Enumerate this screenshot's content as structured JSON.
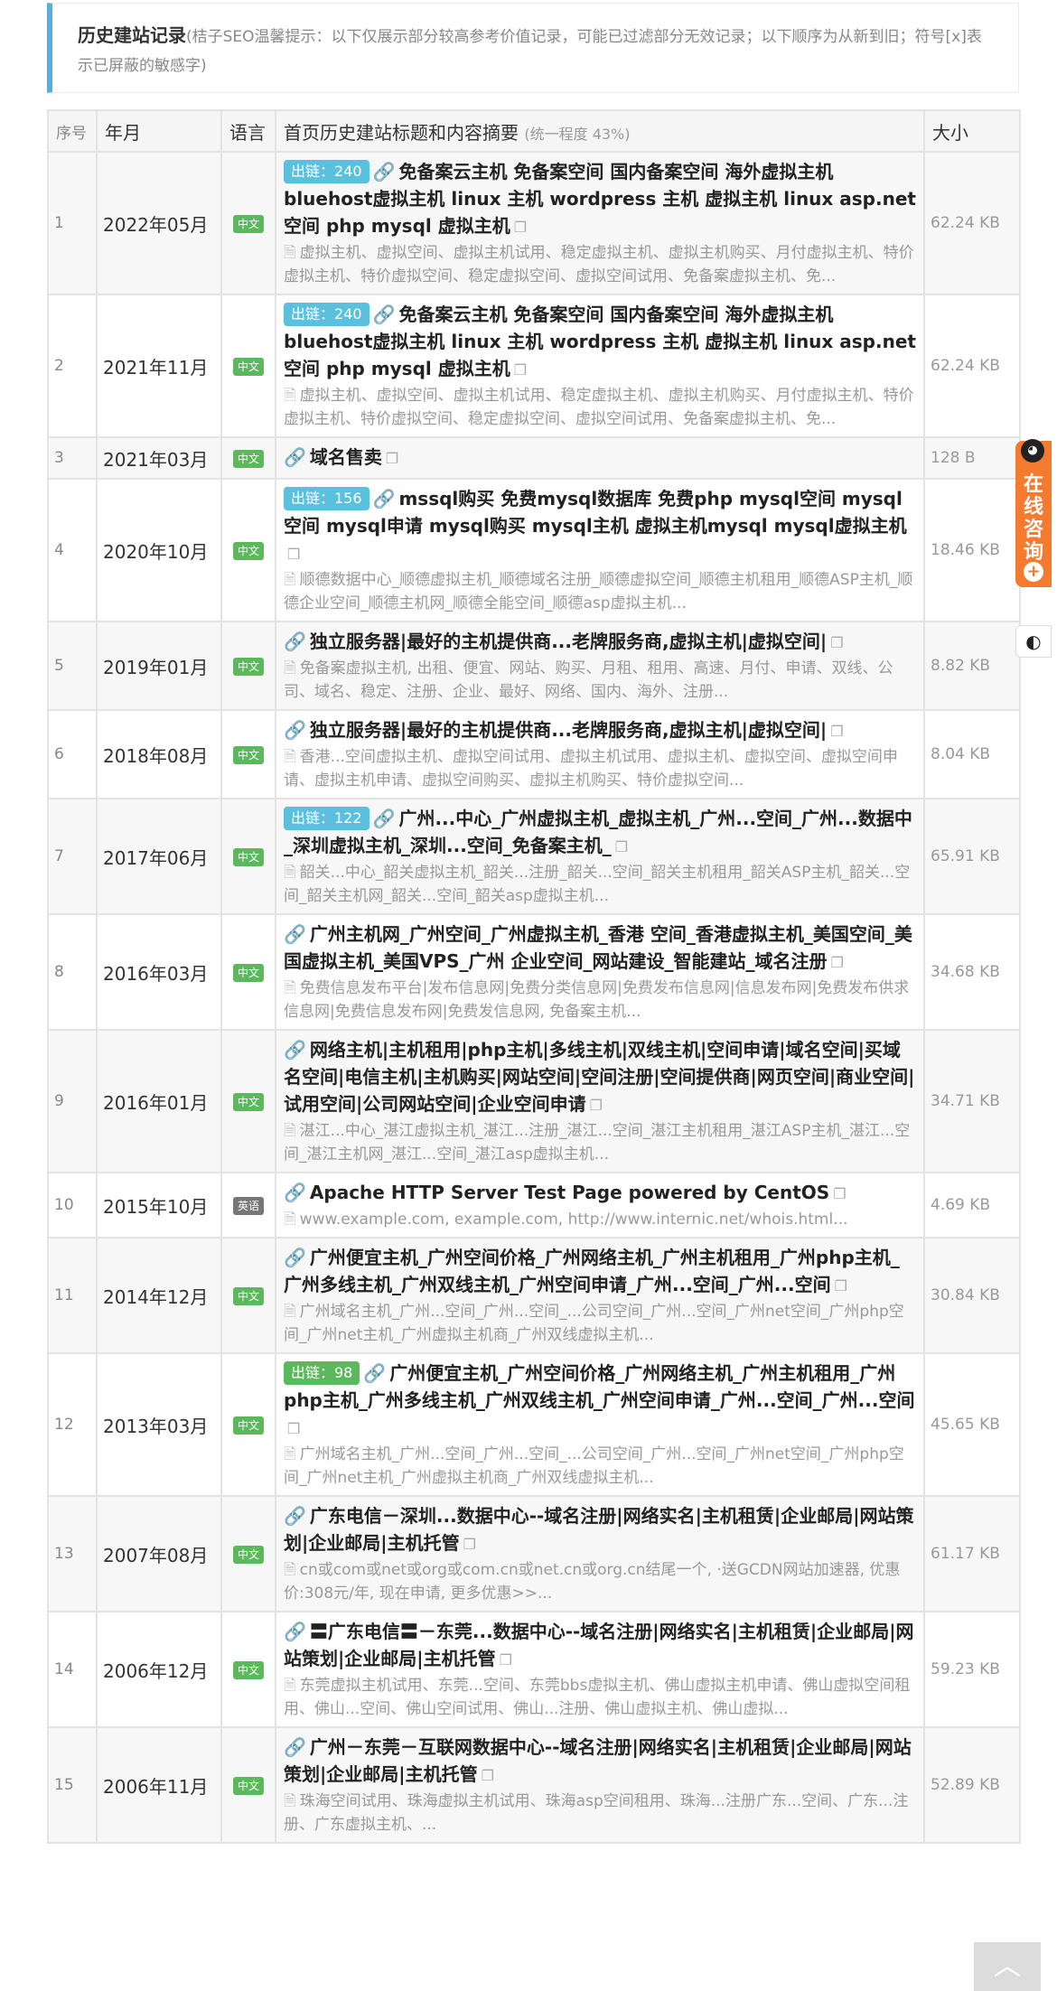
{
  "notice": {
    "title": "历史建站记录",
    "desc": "(桔子SEO温馨提示：以下仅展示部分较高参考价值记录，可能已过滤部分无效记录；以下顺序为从新到旧；符号[x]表示已屏蔽的敏感字)"
  },
  "table": {
    "headers": {
      "seq": "序号",
      "date": "年月",
      "lang": "语言",
      "title": "首页历史建站标题和内容摘要",
      "similarity": "(统一程度 43%)",
      "size": "大小"
    },
    "rows": [
      {
        "seq": "1",
        "date": "2022年05月",
        "lang": "中文",
        "chain": "出链：240",
        "title": "免备案云主机 免备案空间 国内备案空间 海外虚拟主机 bluehost虚拟主机 linux 主机 wordpress 主机 虚拟主机 linux asp.net空间 php mysql 虚拟主机",
        "summary": "虚拟主机、虚拟空间、虚拟主机试用、稳定虚拟主机、虚拟主机购买、月付虚拟主机、特价虚拟主机、特价虚拟空间、稳定虚拟空间、虚拟空间试用、免备案虚拟主机、免...",
        "size": "62.24 KB"
      },
      {
        "seq": "2",
        "date": "2021年11月",
        "lang": "中文",
        "chain": "出链：240",
        "title": "免备案云主机 免备案空间 国内备案空间 海外虚拟主机 bluehost虚拟主机 linux 主机 wordpress 主机 虚拟主机 linux asp.net空间 php mysql 虚拟主机",
        "summary": "虚拟主机、虚拟空间、虚拟主机试用、稳定虚拟主机、虚拟主机购买、月付虚拟主机、特价虚拟主机、特价虚拟空间、稳定虚拟空间、虚拟空间试用、免备案虚拟主机、免...",
        "size": "62.24 KB"
      },
      {
        "seq": "3",
        "date": "2021年03月",
        "lang": "中文",
        "chain": "",
        "title": "域名售卖",
        "summary": "",
        "size": "128 B"
      },
      {
        "seq": "4",
        "date": "2020年10月",
        "lang": "中文",
        "chain": "出链：156",
        "title": "mssql购买 免费mysql数据库 免费php mysql空间 mysql空间 mysql申请 mysql购买 mysql主机 虚拟主机mysql mysql虚拟主机",
        "summary": "顺德数据中心_顺德虚拟主机_顺德域名注册_顺德虚拟空间_顺德主机租用_顺德ASP主机_顺德企业空间_顺德主机网_顺德全能空间_顺德asp虚拟主机...",
        "size": "18.46 KB"
      },
      {
        "seq": "5",
        "date": "2019年01月",
        "lang": "中文",
        "chain": "",
        "title": "独立服务器|最好的主机提供商...老牌服务商,虚拟主机|虚拟空间|",
        "summary": "免备案虚拟主机, 出租、便宜、网站、购买、月租、租用、高速、月付、申请、双线、公司、域名、稳定、注册、企业、最好、网络、国内、海外、注册...",
        "size": "8.82 KB"
      },
      {
        "seq": "6",
        "date": "2018年08月",
        "lang": "中文",
        "chain": "",
        "title": "独立服务器|最好的主机提供商...老牌服务商,虚拟主机|虚拟空间|",
        "summary": "香港...空间虚拟主机、虚拟空间试用、虚拟主机试用、虚拟主机、虚拟空间、虚拟空间申请、虚拟主机申请、虚拟空间购买、虚拟主机购买、特价虚拟空间...",
        "size": "8.04 KB"
      },
      {
        "seq": "7",
        "date": "2017年06月",
        "lang": "中文",
        "chain": "出链：122",
        "title": "广州...中心_广州虚拟主机_虚拟主机_广州...空间_广州...数据中_深圳虚拟主机_深圳...空间_免备案主机_",
        "summary": "韶关...中心_韶关虚拟主机_韶关...注册_韶关...空间_韶关主机租用_韶关ASP主机_韶关...空间_韶关主机网_韶关...空间_韶关asp虚拟主机...",
        "size": "65.91 KB"
      },
      {
        "seq": "8",
        "date": "2016年03月",
        "lang": "中文",
        "chain": "",
        "title": "广州主机网_广州空间_广州虚拟主机_香港 空间_香港虚拟主机_美国空间_美国虚拟主机_美国VPS_广州 企业空间_网站建设_智能建站_域名注册",
        "summary": "免费信息发布平台|发布信息网|免费分类信息网|免费发布信息网|信息发布网|免费发布供求信息网|免费信息发布网|免费发信息网, 免备案主机...",
        "size": "34.68 KB"
      },
      {
        "seq": "9",
        "date": "2016年01月",
        "lang": "中文",
        "chain": "",
        "title": "网络主机|主机租用|php主机|多线主机|双线主机|空间申请|域名空间|买域名空间|电信主机|主机购买|网站空间|空间注册|空间提供商|网页空间|商业空间|试用空间|公司网站空间|企业空间申请",
        "summary": "湛江...中心_湛江虚拟主机_湛江...注册_湛江...空间_湛江主机租用_湛江ASP主机_湛江...空间_湛江主机网_湛江...空间_湛江asp虚拟主机...",
        "size": "34.71 KB"
      },
      {
        "seq": "10",
        "date": "2015年10月",
        "lang": "英语",
        "chain": "",
        "title": "Apache HTTP Server Test Page powered by CentOS",
        "summary": "www.example.com, example.com, http://www.internic.net/whois.html...",
        "size": "4.69 KB"
      },
      {
        "seq": "11",
        "date": "2014年12月",
        "lang": "中文",
        "chain": "",
        "title": "广州便宜主机_广州空间价格_广州网络主机_广州主机租用_广州php主机_广州多线主机_广州双线主机_广州空间申请_广州...空间_广州...空间",
        "summary": "广州域名主机_广州...空间_广州...空间_...公司空间_广州...空间_广州net空间_广州php空间_广州net主机_广州虚拟主机商_广州双线虚拟主机...",
        "size": "30.84 KB"
      },
      {
        "seq": "12",
        "date": "2013年03月",
        "lang": "中文",
        "chain": "出链：98",
        "title": "广州便宜主机_广州空间价格_广州网络主机_广州主机租用_广州php主机_广州多线主机_广州双线主机_广州空间申请_广州...空间_广州...空间",
        "summary": "广州域名主机_广州...空间_广州...空间_...公司空间_广州...空间_广州net空间_广州php空间_广州net主机_广州虚拟主机商_广州双线虚拟主机...",
        "size": "45.65 KB"
      },
      {
        "seq": "13",
        "date": "2007年08月",
        "lang": "中文",
        "chain": "",
        "title": "广东电信－深圳...数据中心--域名注册|网络实名|主机租赁|企业邮局|网站策划|企业邮局|主机托管",
        "summary": "cn或com或net或org或com.cn或net.cn或org.cn结尾一个, ·送GCDN网站加速器, 优惠价:308元/年, 现在申请, 更多优惠>>...",
        "size": "61.17 KB"
      },
      {
        "seq": "14",
        "date": "2006年12月",
        "lang": "中文",
        "chain": "",
        "title": "〓广东电信〓－东莞...数据中心--域名注册|网络实名|主机租赁|企业邮局|网站策划|企业邮局|主机托管",
        "summary": "东莞虚拟主机试用、东莞...空间、东莞bbs虚拟主机、佛山虚拟主机申请、佛山虚拟空间租用、佛山...空间、佛山空间试用、佛山...注册、佛山虚拟主机、佛山虚拟...",
        "size": "59.23 KB"
      },
      {
        "seq": "15",
        "date": "2006年11月",
        "lang": "中文",
        "chain": "",
        "title": "广州－东莞－互联网数据中心--域名注册|网络实名|主机租赁|企业邮局|网站策划|企业邮局|主机托管",
        "summary": "珠海空间试用、珠海虚拟主机试用、珠海asp空间租用、珠海...注册广东...空间、广东...注册、广东虚拟主机、...",
        "size": "52.89 KB"
      }
    ]
  },
  "side": {
    "consult_label": "在线咨询",
    "qq_icon": "qq-penguin-icon",
    "contrast_icon": "contrast-icon",
    "top_icon": "chevron-up-icon"
  },
  "colors": {
    "accent_blue": "#5bc0de",
    "chain_green": "#5cb85c",
    "lang_cn": "#5cb85c",
    "lang_en": "#777777",
    "side_orange": "#f47a30",
    "notice_border": "#5aaedc"
  }
}
